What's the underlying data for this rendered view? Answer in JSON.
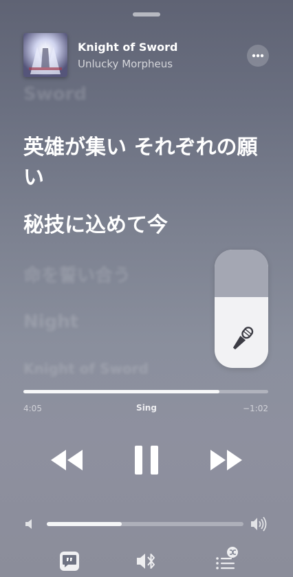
{
  "now_playing": {
    "title": "Knight of Sword",
    "artist": "Unlucky Morpheus",
    "album_art_icon": "album-art"
  },
  "lyrics": {
    "previous": "Sword",
    "current_line_1": "英雄が集い それぞれの願い",
    "current_line_2": "秘技に込めて今",
    "next_1": "命を誓い合う",
    "next_2": "Night",
    "next_3": "Knight of Sword"
  },
  "sing": {
    "label": "Sing",
    "vocal_level": 0.4,
    "icon": "microphone-icon"
  },
  "playback": {
    "elapsed": "4:05",
    "remaining": "−1:02",
    "progress": 0.8
  },
  "volume": {
    "level": 0.38
  },
  "colors": {
    "background": "#7c8190",
    "sing_panel": "#f2f2f4",
    "sing_fill": "#a4a7b3"
  }
}
